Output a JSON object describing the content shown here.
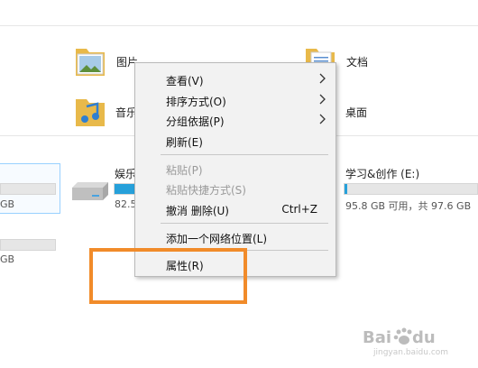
{
  "folders": {
    "pictures": "图片",
    "music": "音乐",
    "documents": "文档",
    "desktop": "桌面"
  },
  "drives": {
    "left": {
      "size": "GB",
      "size2": "GB"
    },
    "entertainment": {
      "name": "娱乐",
      "free": "82.5"
    },
    "study": {
      "name": "学习&创作 (E:)",
      "free": "95.8 GB 可用，共 97.6 GB",
      "used_fraction": 0.02
    }
  },
  "context_menu": {
    "view": "查看(V)",
    "sort": "排序方式(O)",
    "group": "分组依据(P)",
    "refresh": "刷新(E)",
    "paste": "粘贴(P)",
    "paste_shortcut": "粘贴快捷方式(S)",
    "undo": "撤消 删除(U)",
    "undo_shortcut": "Ctrl+Z",
    "add_network": "添加一个网络位置(L)",
    "properties": "属性(R)"
  },
  "watermark": {
    "brand": "Bai",
    "paw": "du",
    "sub": "jingyan.baidu.com"
  },
  "colors": {
    "accent": "#26a0da",
    "highlight": "#f18b2a"
  }
}
